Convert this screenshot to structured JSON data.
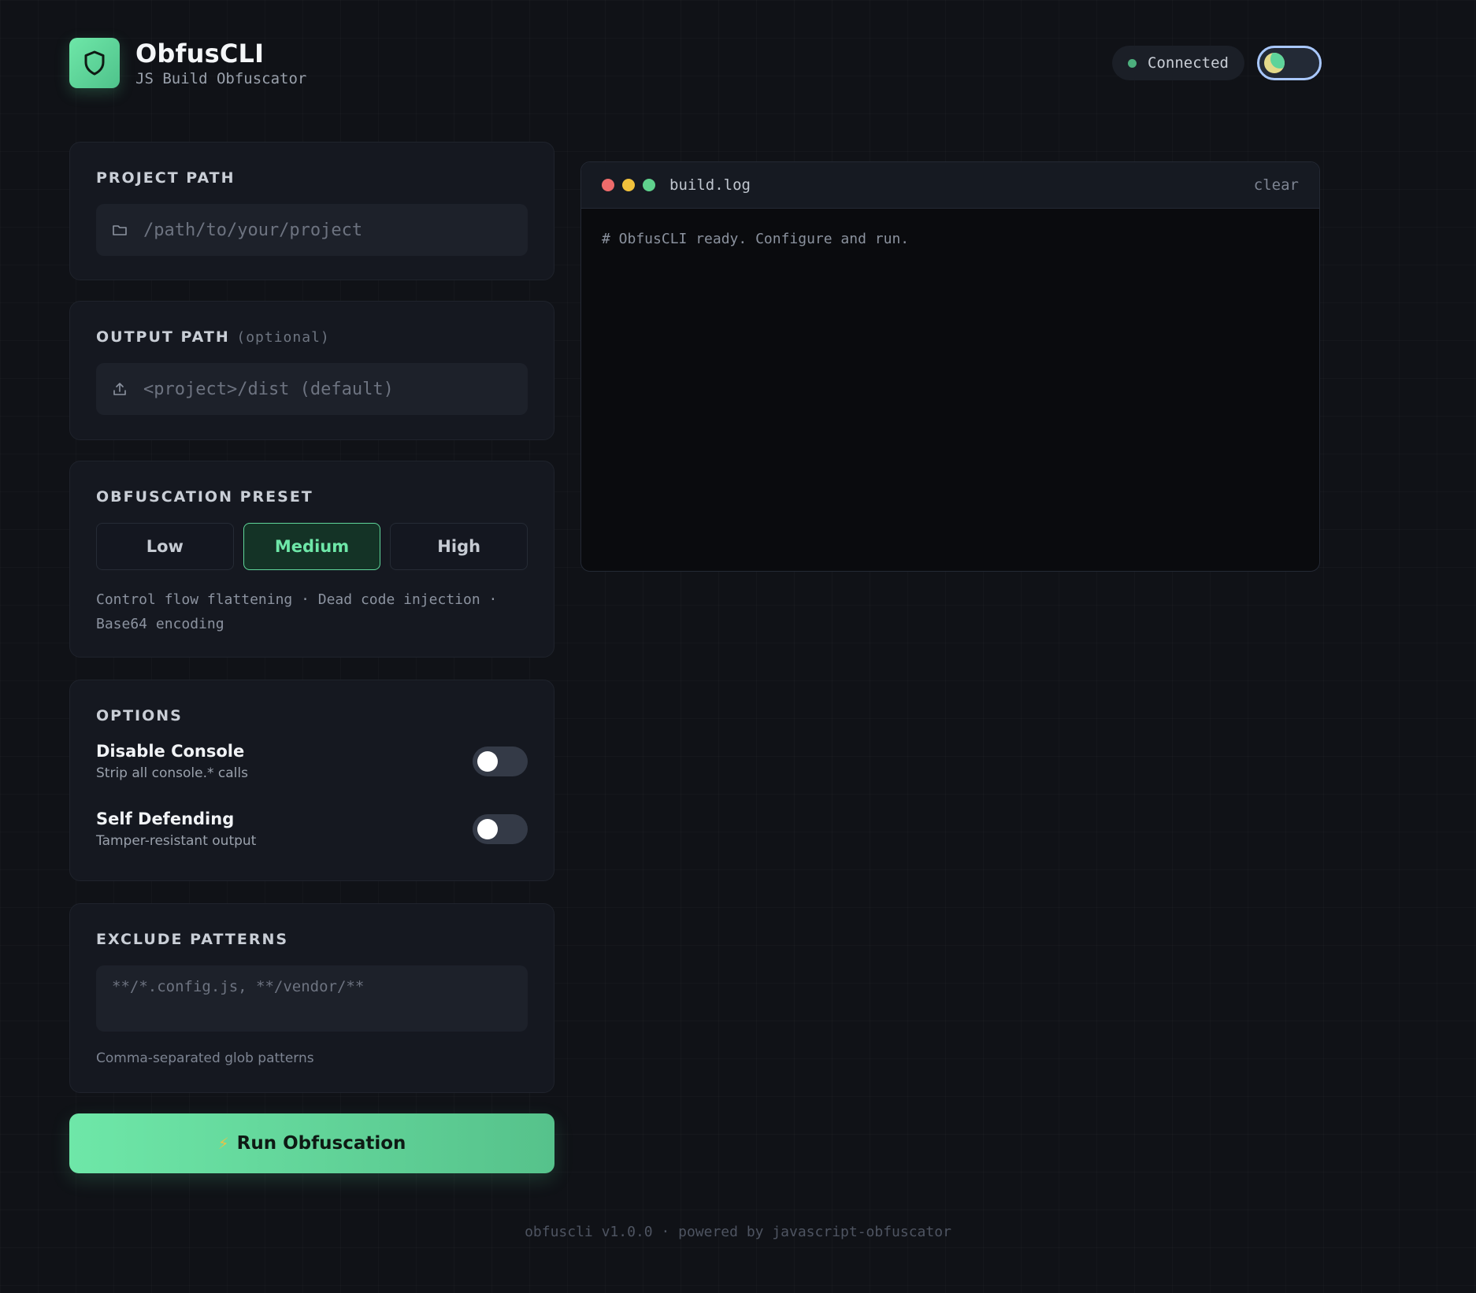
{
  "header": {
    "title": "ObfusCLI",
    "subtitle": "JS Build Obfuscator",
    "status": "Connected"
  },
  "project_path": {
    "label": "PROJECT PATH",
    "placeholder": "/path/to/your/project"
  },
  "output_path": {
    "label": "OUTPUT PATH",
    "optional": "(optional)",
    "placeholder": "<project>/dist (default)"
  },
  "preset": {
    "label": "OBFUSCATION PRESET",
    "options": [
      "Low",
      "Medium",
      "High"
    ],
    "selected": "Medium",
    "description": "Control flow flattening · Dead code injection · Base64 encoding"
  },
  "options": {
    "label": "OPTIONS",
    "items": [
      {
        "title": "Disable Console",
        "subtitle": "Strip all console.* calls",
        "enabled": false
      },
      {
        "title": "Self Defending",
        "subtitle": "Tamper-resistant output",
        "enabled": false
      }
    ]
  },
  "exclude": {
    "label": "EXCLUDE PATTERNS",
    "placeholder": "**/*.config.js, **/vendor/**",
    "hint": "Comma-separated glob patterns"
  },
  "run_button": {
    "label": "Run Obfuscation",
    "icon": "bolt-icon"
  },
  "terminal": {
    "title": "build.log",
    "clear": "clear",
    "lines": [
      "# ObfusCLI ready. Configure and run."
    ]
  },
  "footer": "obfuscli v1.0.0 · powered by javascript-obfuscator",
  "colors": {
    "accent": "#6ee7a8",
    "background": "#101217",
    "status_dot": "#4caf7d",
    "dot_red": "#ee6b6b",
    "dot_yellow": "#f2c23c",
    "dot_green": "#5fd28d"
  }
}
